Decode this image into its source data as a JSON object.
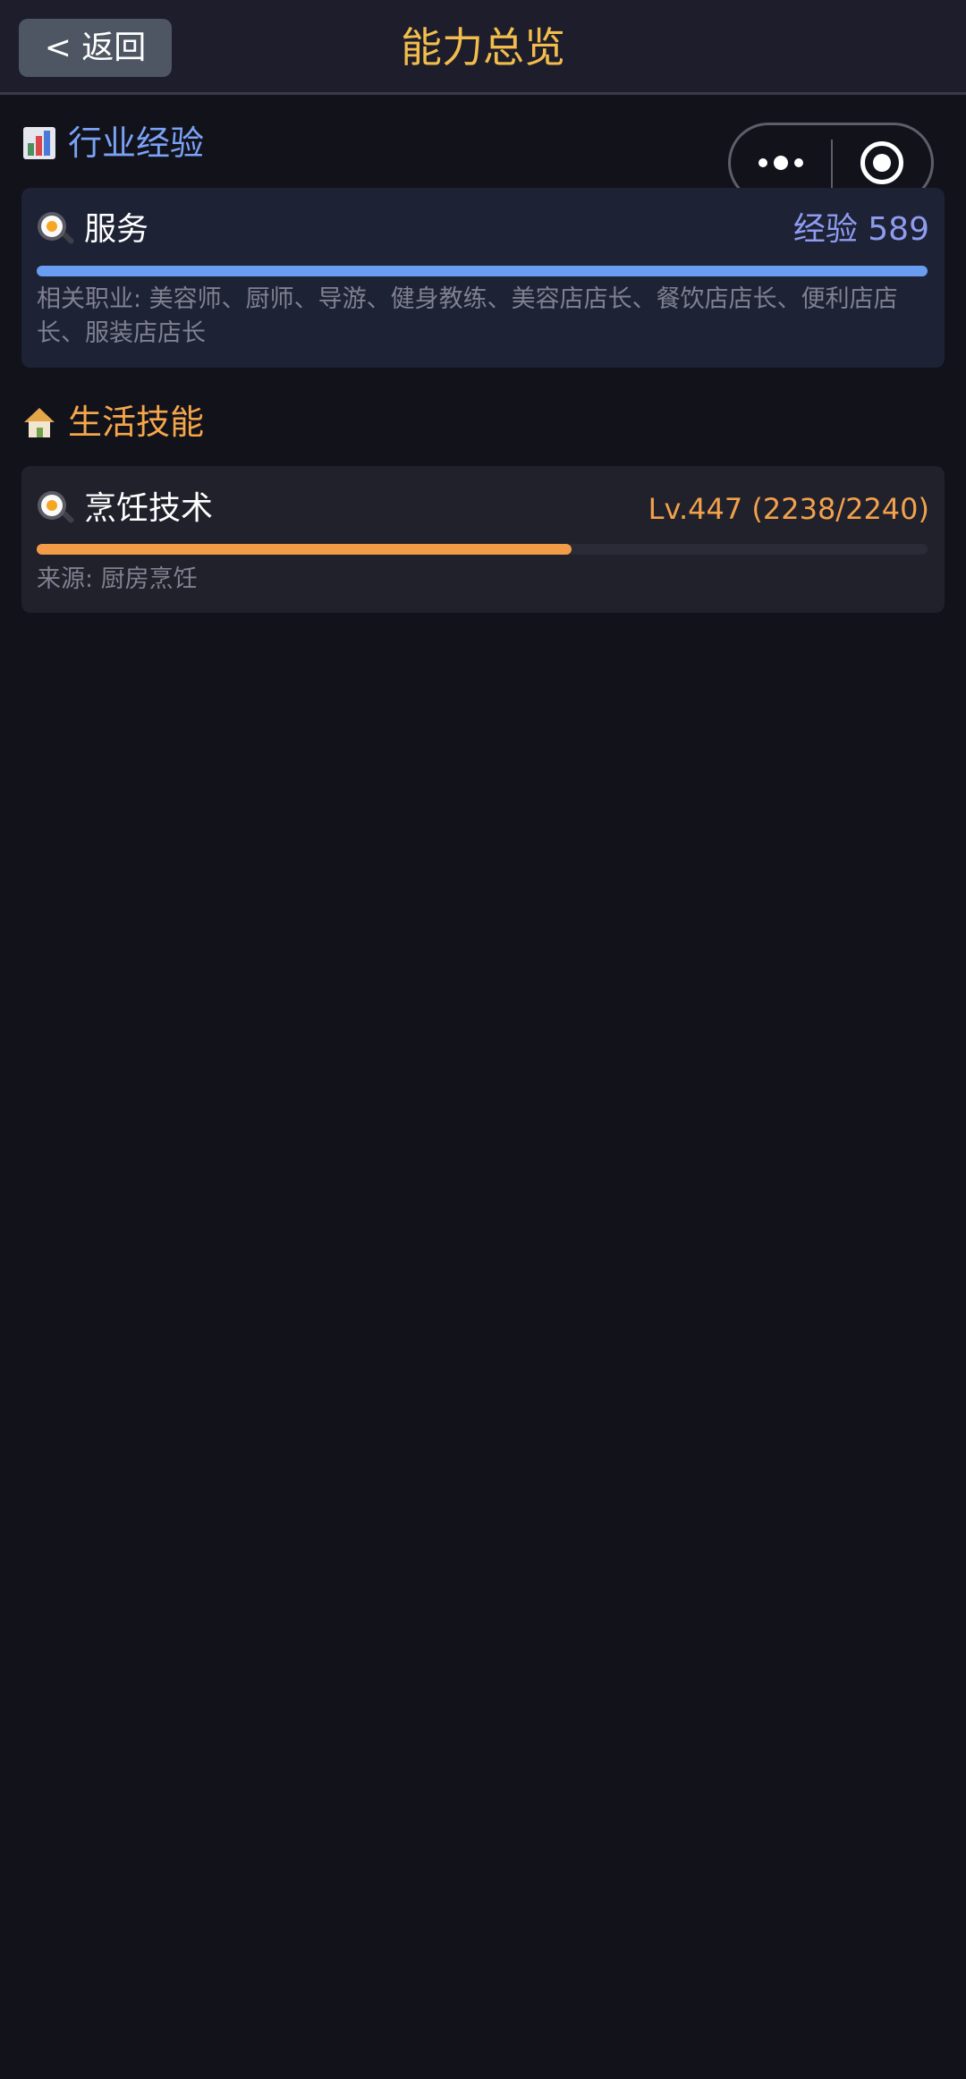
{
  "header": {
    "back_label": "< 返回",
    "title": "能力总览"
  },
  "capsule": {
    "more_icon": "more-dots-icon",
    "close_icon": "record-circle-icon"
  },
  "industry_section": {
    "icon": "bar-chart-icon",
    "title": "行业经验",
    "items": [
      {
        "icon": "frying-pan-egg-icon",
        "name": "服务",
        "value": "经验 589",
        "progress": 1.0,
        "description": "相关职业: 美容师、厨师、导游、健身教练、美容店店长、餐饮店店长、便利店店长、服装店店长"
      }
    ]
  },
  "life_section": {
    "icon": "house-icon",
    "title": "生活技能",
    "items": [
      {
        "icon": "frying-pan-egg-icon",
        "name": "烹饪技术",
        "value": "Lv.447 (2238/2240)",
        "progress": 0.6,
        "description": "来源: 厨房烹饪"
      }
    ]
  },
  "colors": {
    "background": "#12121b",
    "title_gold": "#f2bd4c",
    "industry_blue": "#7aa2f5",
    "life_orange": "#f5a64a"
  }
}
